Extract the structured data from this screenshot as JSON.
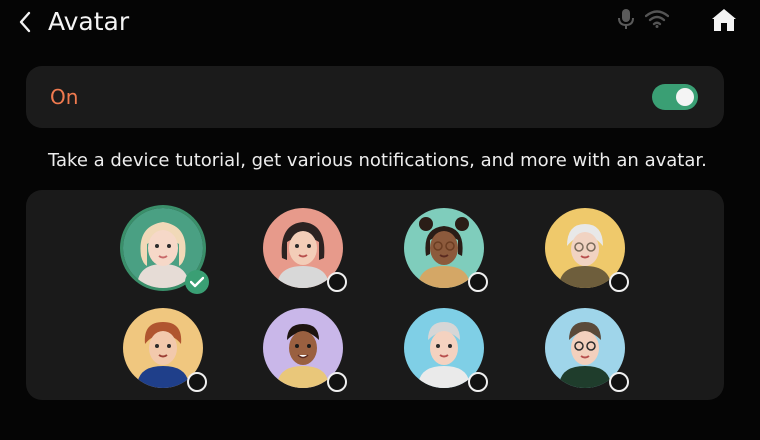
{
  "header": {
    "title": "Avatar",
    "back_icon": "chevron-left-icon",
    "status_icons": [
      "mic-icon",
      "wifi-icon"
    ],
    "home_icon": "home-icon"
  },
  "setting": {
    "label": "On",
    "toggle_on": true,
    "label_color": "#f07a4f",
    "toggle_color": "#3a9f74"
  },
  "description": "Take a device tutorial, get various notifications, and more with an avatar.",
  "avatars": [
    {
      "id": "avatar-1",
      "selected": true,
      "bg": "#4aa083"
    },
    {
      "id": "avatar-2",
      "selected": false,
      "bg": "#e79a8b"
    },
    {
      "id": "avatar-3",
      "selected": false,
      "bg": "#7fcdbc"
    },
    {
      "id": "avatar-4",
      "selected": false,
      "bg": "#efc96b"
    },
    {
      "id": "avatar-5",
      "selected": false,
      "bg": "#f0c77f"
    },
    {
      "id": "avatar-6",
      "selected": false,
      "bg": "#c9b7e9"
    },
    {
      "id": "avatar-7",
      "selected": false,
      "bg": "#7fcfe6"
    },
    {
      "id": "avatar-8",
      "selected": false,
      "bg": "#9fd5ea"
    }
  ]
}
